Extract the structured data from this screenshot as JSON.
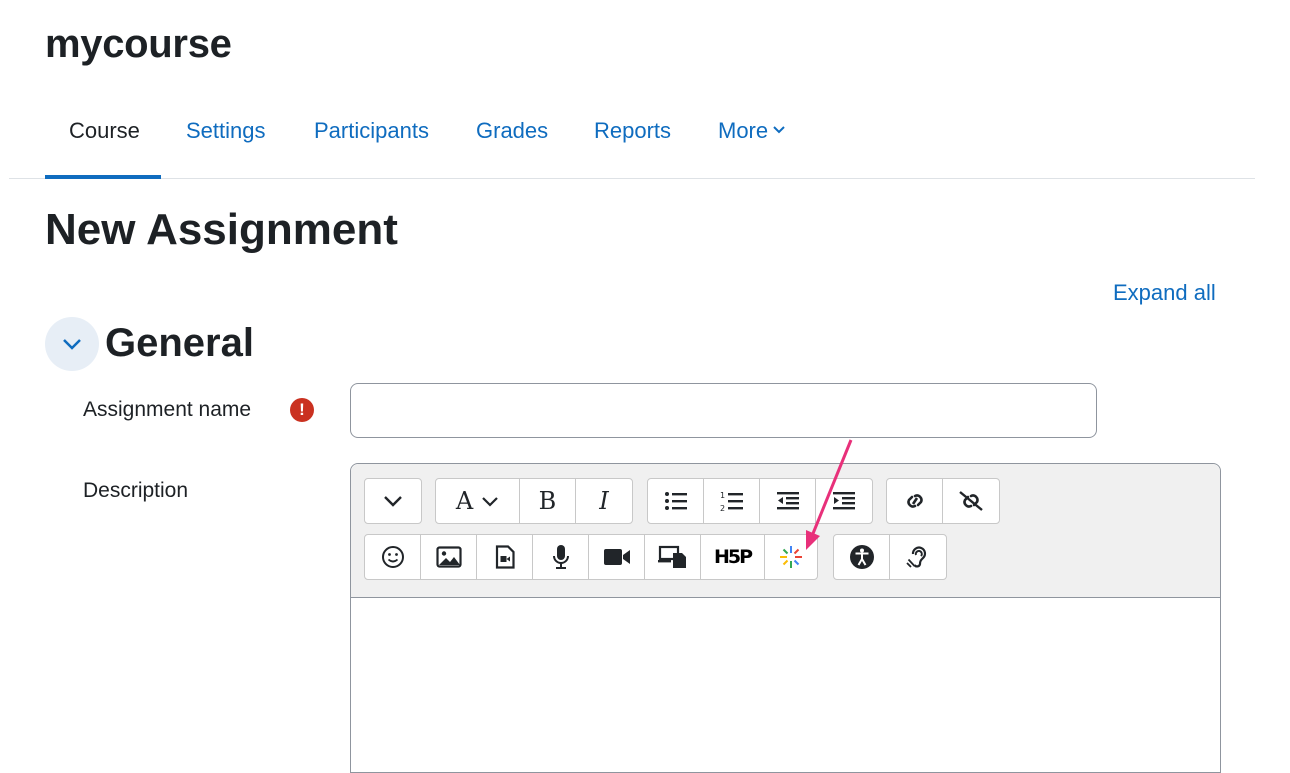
{
  "course": {
    "title": "mycourse"
  },
  "nav": {
    "tabs": [
      {
        "label": "Course",
        "active": true
      },
      {
        "label": "Settings"
      },
      {
        "label": "Participants"
      },
      {
        "label": "Grades"
      },
      {
        "label": "Reports"
      },
      {
        "label": "More"
      }
    ]
  },
  "page": {
    "title": "New Assignment",
    "expand_all": "Expand all"
  },
  "section": {
    "title": "General"
  },
  "form": {
    "assignment_name": {
      "label": "Assignment name",
      "value": "",
      "required_icon": "!"
    },
    "description": {
      "label": "Description"
    }
  },
  "editor_toolbar": {
    "row1": [
      "collapse-toolbar-icon",
      "font-style-icon",
      "bold-icon",
      "italic-icon",
      "unordered-list-icon",
      "ordered-list-icon",
      "outdent-icon",
      "indent-icon",
      "link-icon",
      "unlink-icon"
    ],
    "row2": [
      "emoji-icon",
      "image-icon",
      "media-file-icon",
      "record-audio-icon",
      "record-video-icon",
      "manage-files-icon",
      "h5p-icon",
      "kaltura-embed-icon",
      "accessibility-checker-icon",
      "screen-reader-helper-icon"
    ],
    "bold_glyph": "B",
    "italic_glyph": "I",
    "font_glyph": "A",
    "h5p_text": "H5P"
  },
  "colors": {
    "accent": "#0f6cbf",
    "required": "#ca3120",
    "annotation_arrow": "#e8307a"
  }
}
